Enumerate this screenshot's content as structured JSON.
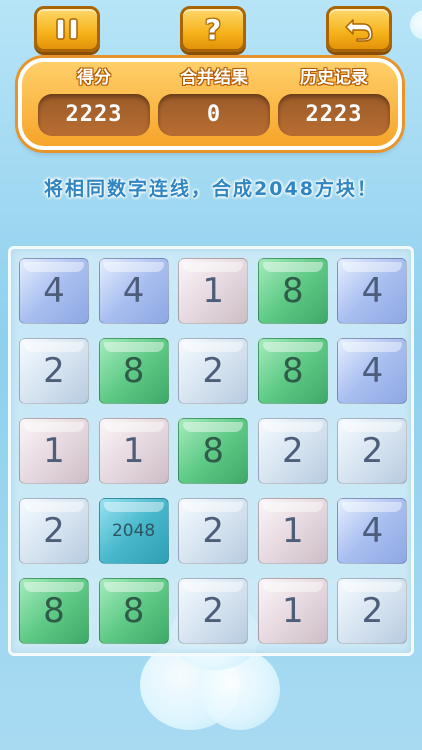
{
  "toolbar": {
    "pause_icon": "pause-icon",
    "help_label": "?",
    "back_icon": "back-arrow-icon"
  },
  "scores": {
    "score_label": "得分",
    "score_value": "2223",
    "merge_label": "合并结果",
    "merge_value": "0",
    "best_label": "历史记录",
    "best_value": "2223"
  },
  "hint": "将相同数字连线，合成2048方块！",
  "board": {
    "rows": [
      [
        "4",
        "4",
        "1",
        "8",
        "4"
      ],
      [
        "2",
        "8",
        "2",
        "8",
        "4"
      ],
      [
        "1",
        "1",
        "8",
        "2",
        "2"
      ],
      [
        "2",
        "2048",
        "2",
        "1",
        "4"
      ],
      [
        "8",
        "8",
        "2",
        "1",
        "2"
      ]
    ]
  },
  "colors": {
    "accent": "#f5b21a",
    "tile_1": "#e6d9df",
    "tile_2": "#d7e4f1",
    "tile_4": "#a9bff0",
    "tile_8": "#5fca86",
    "tile_2048": "#49b8cc"
  }
}
